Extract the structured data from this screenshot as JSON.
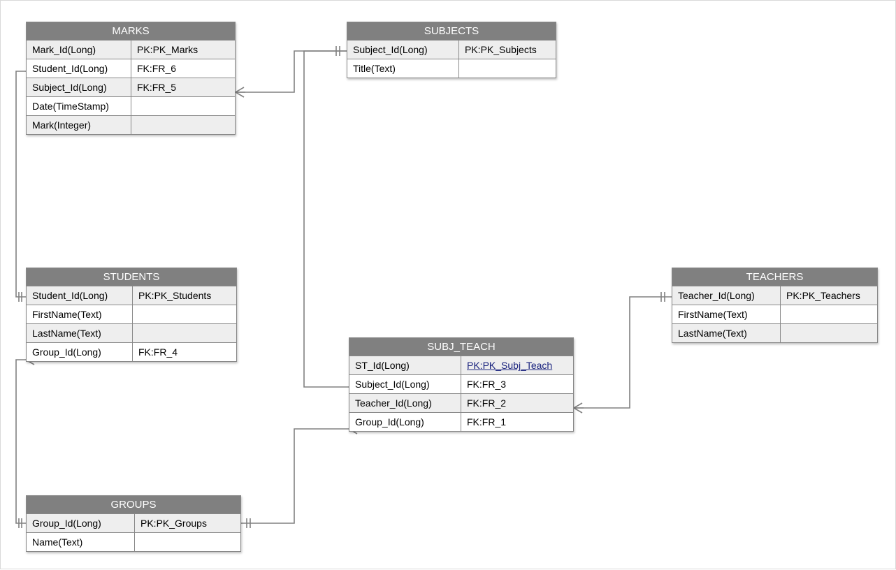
{
  "entities": {
    "marks": {
      "title": "MARKS",
      "rows": [
        {
          "col0": "Mark_Id(Long)",
          "col1": "PK:PK_Marks",
          "shaded": true
        },
        {
          "col0": "Student_Id(Long)",
          "col1": "FK:FR_6",
          "shaded": false
        },
        {
          "col0": "Subject_Id(Long)",
          "col1": "FK:FR_5",
          "shaded": true
        },
        {
          "col0": "Date(TimeStamp)",
          "col1": "",
          "shaded": false
        },
        {
          "col0": "Mark(Integer)",
          "col1": "",
          "shaded": true
        }
      ]
    },
    "subjects": {
      "title": "SUBJECTS",
      "rows": [
        {
          "col0": "Subject_Id(Long)",
          "col1": "PK:PK_Subjects",
          "shaded": true
        },
        {
          "col0": "Title(Text)",
          "col1": "",
          "shaded": false
        }
      ]
    },
    "students": {
      "title": "STUDENTS",
      "rows": [
        {
          "col0": "Student_Id(Long)",
          "col1": "PK:PK_Students",
          "shaded": true
        },
        {
          "col0": "FirstName(Text)",
          "col1": "",
          "shaded": false
        },
        {
          "col0": "LastName(Text)",
          "col1": "",
          "shaded": true
        },
        {
          "col0": "Group_Id(Long)",
          "col1": "FK:FR_4",
          "shaded": false
        }
      ]
    },
    "subj_teach": {
      "title": "SUBJ_TEACH",
      "rows": [
        {
          "col0": "ST_Id(Long)",
          "col1": "PK:PK_Subj_Teach",
          "shaded": true,
          "pk": true
        },
        {
          "col0": "Subject_Id(Long)",
          "col1": "FK:FR_3",
          "shaded": false
        },
        {
          "col0": "Teacher_Id(Long)",
          "col1": "FK:FR_2",
          "shaded": true
        },
        {
          "col0": "Group_Id(Long)",
          "col1": "FK:FR_1",
          "shaded": false
        }
      ]
    },
    "teachers": {
      "title": "TEACHERS",
      "rows": [
        {
          "col0": "Teacher_Id(Long)",
          "col1": "PK:PK_Teachers",
          "shaded": true
        },
        {
          "col0": "FirstName(Text)",
          "col1": "",
          "shaded": false
        },
        {
          "col0": "LastName(Text)",
          "col1": "",
          "shaded": true
        }
      ]
    },
    "groups": {
      "title": "GROUPS",
      "rows": [
        {
          "col0": "Group_Id(Long)",
          "col1": "PK:PK_Groups",
          "shaded": true
        },
        {
          "col0": "Name(Text)",
          "col1": "",
          "shaded": false
        }
      ]
    }
  }
}
